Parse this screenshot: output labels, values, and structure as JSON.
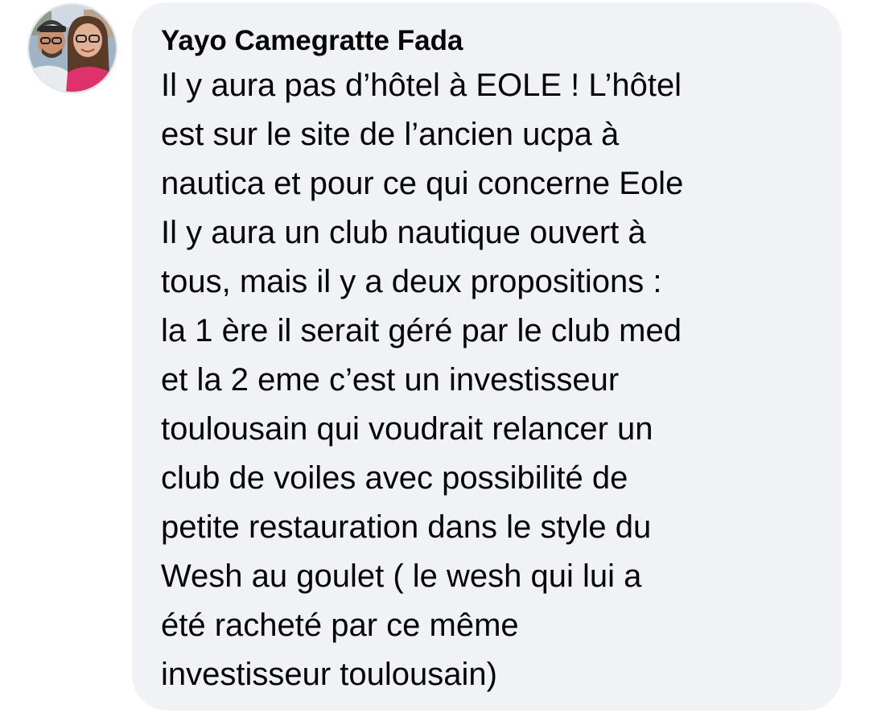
{
  "comment": {
    "author": "Yayo Camegratte Fada",
    "lines": [
      "Il y aura pas d’hôtel à EOLE ! L’hôtel",
      "est sur le site de l’ancien ucpa à",
      "nautica et pour ce qui concerne Eole",
      "Il y aura un club nautique ouvert à",
      "tous, mais il y a deux propositions :",
      "la 1 ère il serait géré par le club med",
      "et la 2 eme c’est un investisseur",
      "toulousain qui voudrait relancer un",
      "club de voiles avec possibilité de",
      "petite restauration dans le style du",
      "Wesh au goulet ( le wesh qui lui a",
      "été racheté par ce même",
      "investisseur toulousain)"
    ]
  },
  "colors": {
    "bubble_background": "#f0f2f5",
    "text": "#050505",
    "avatar_border": "#e4e6eb"
  },
  "icons": {
    "avatar": "profile-photo-two-people"
  }
}
